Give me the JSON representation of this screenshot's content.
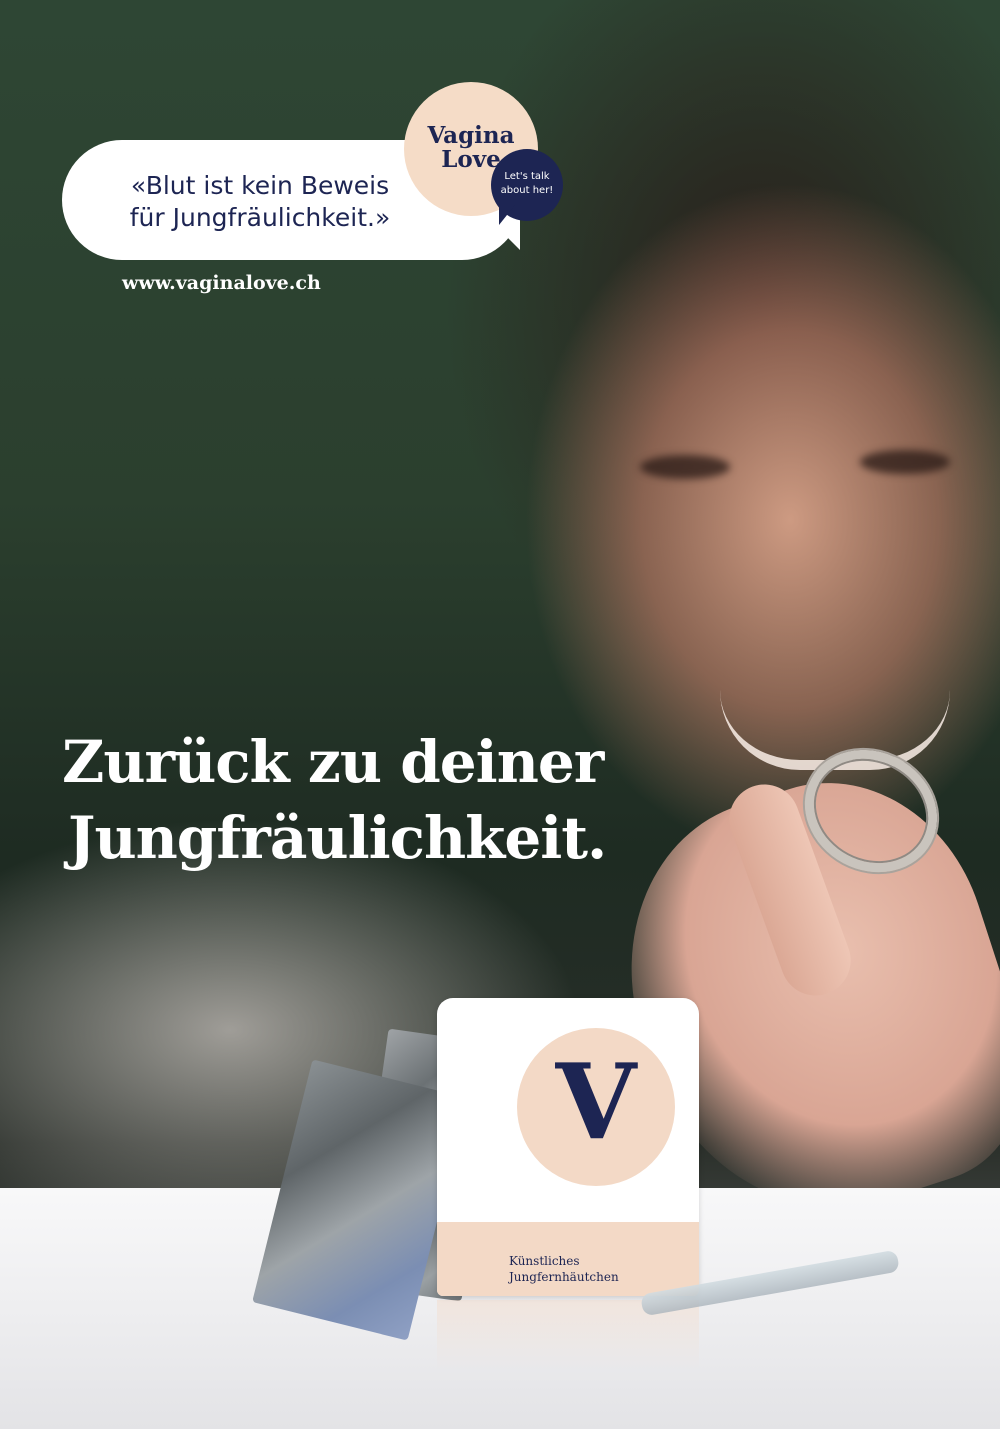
{
  "campaign": {
    "quote_line1": "«Blut ist kein Beweis",
    "quote_line2": "für Jungfräulichkeit.»",
    "url": "www.vaginalove.ch"
  },
  "logo": {
    "line1": "Vagina",
    "line2": "Love",
    "badge_line1": "Let's talk",
    "badge_line2": "about her!"
  },
  "headline": {
    "line1": "Zurück zu deiner",
    "line2": "Jungfräulichkeit."
  },
  "product": {
    "letter": "V",
    "label_line1": "Künstliches",
    "label_line2": "Jungfernhäutchen"
  },
  "colors": {
    "navy": "#1d2553",
    "peach": "#f5dcc7",
    "white": "#ffffff"
  },
  "icons": [
    "speech-bubble-icon",
    "ring-icon",
    "tweezers-icon"
  ]
}
